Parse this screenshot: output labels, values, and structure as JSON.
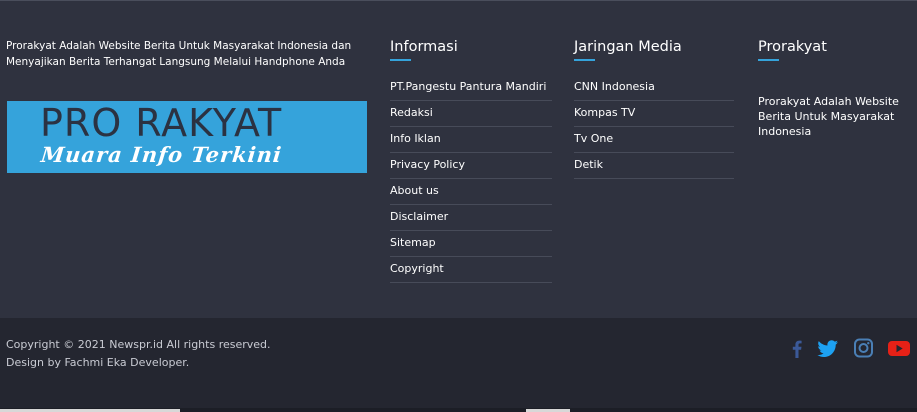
{
  "about": {
    "text": "Prorakyat Adalah Website Berita Untuk Masyarakat Indonesia dan Menyajikan Berita Terhangat Langsung Melalui Handphone Anda",
    "logo_title": "PRO RAKYAT",
    "logo_subtitle": "Muara Info Terkini"
  },
  "informasi": {
    "title": "Informasi",
    "links": [
      "PT.Pangestu Pantura Mandiri",
      "Redaksi",
      "Info Iklan",
      "Privacy Policy",
      "About us",
      "Disclaimer",
      "Sitemap",
      "Copyright"
    ]
  },
  "jaringan": {
    "title": "Jaringan Media",
    "links": [
      "CNN Indonesia",
      "Kompas TV",
      "Tv One",
      "Detik"
    ]
  },
  "prorakyat": {
    "title": "Prorakyat",
    "text": "Prorakyat Adalah Website Berita Untuk Masyarakat Indonesia"
  },
  "footer": {
    "copyright": "Copyright © 2021 Newspr.id All rights reserved.",
    "design": "Design by Fachmi Eka Developer."
  },
  "social": [
    {
      "icon": "facebook-icon",
      "color": "#3b5998"
    },
    {
      "icon": "twitter-icon",
      "color": "#1da1f2"
    },
    {
      "icon": "instagram-icon",
      "color": "#4a7fb5"
    },
    {
      "icon": "youtube-icon",
      "color": "#e62117"
    }
  ],
  "colors": {
    "background": "#2f323f",
    "bottom_bar": "#242630",
    "accent": "#35a3db"
  }
}
